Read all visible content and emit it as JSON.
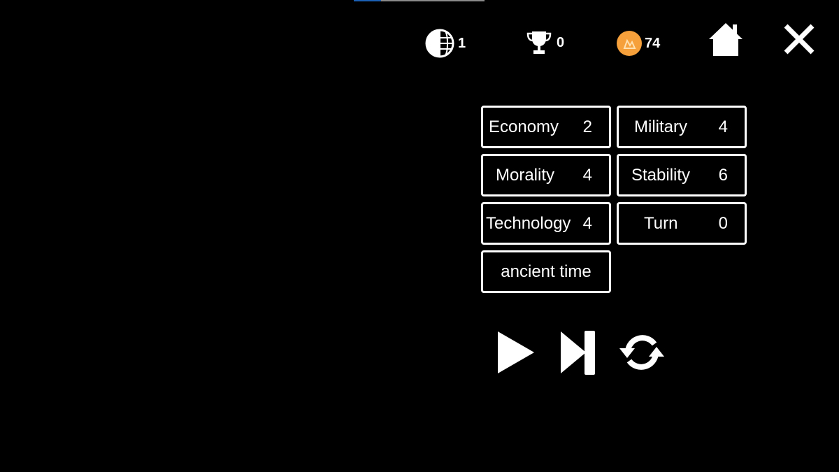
{
  "progress": {
    "value": 0.21,
    "fill_color": "#1a5fb4"
  },
  "hud": {
    "level": "1",
    "trophies": "0",
    "coins": "74",
    "coin_color": "#f5a03a"
  },
  "stats": [
    {
      "label": "Economy",
      "value": "2"
    },
    {
      "label": "Military",
      "value": "4"
    },
    {
      "label": "Morality",
      "value": "4"
    },
    {
      "label": "Stability",
      "value": "6"
    },
    {
      "label": "Technology",
      "value": "4"
    },
    {
      "label": "Turn",
      "value": "0"
    }
  ],
  "era": "ancient time",
  "controls": [
    "play-icon",
    "skip-forward-icon",
    "refresh-icon"
  ]
}
